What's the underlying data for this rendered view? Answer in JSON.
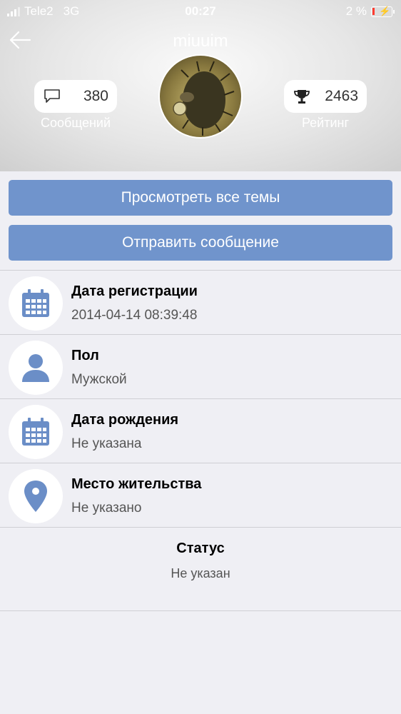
{
  "status_bar": {
    "carrier": "Tele2",
    "network": "3G",
    "time": "00:27",
    "battery_percent": "2 %"
  },
  "header": {
    "username": "miuuim",
    "messages": {
      "count": "380",
      "label": "Сообщений",
      "icon": "speech-bubble-icon"
    },
    "rating": {
      "count": "2463",
      "label": "Рейтинг",
      "icon": "trophy-icon"
    }
  },
  "actions": {
    "view_topics": "Просмотреть все темы",
    "send_message": "Отправить сообщение"
  },
  "info": [
    {
      "title": "Дата регистрации",
      "value": "2014-04-14 08:39:48",
      "icon": "calendar-icon"
    },
    {
      "title": "Пол",
      "value": "Мужской",
      "icon": "person-icon"
    },
    {
      "title": "Дата рождения",
      "value": "Не указана",
      "icon": "calendar-icon"
    },
    {
      "title": "Место жительства",
      "value": "Не указано",
      "icon": "location-pin-icon"
    }
  ],
  "status": {
    "title": "Статус",
    "value": "Не указан"
  },
  "colors": {
    "accent": "#7094cc",
    "background": "#efeff4",
    "battery_low": "#ff3b30"
  }
}
